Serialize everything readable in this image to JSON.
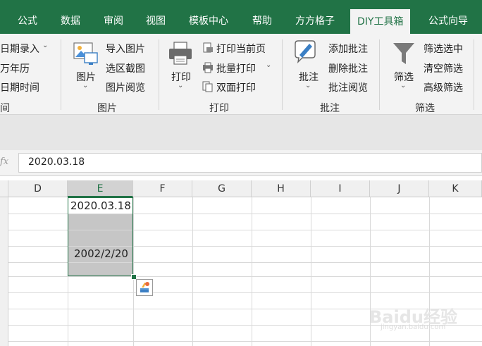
{
  "tabs": [
    "公式",
    "数据",
    "审阅",
    "视图",
    "模板中心",
    "帮助",
    "方方格子",
    "DIY工具箱",
    "公式向导"
  ],
  "ribbon": {
    "date_group": {
      "items": [
        "日期录入",
        "万年历",
        "日期时间"
      ],
      "label": "间"
    },
    "image_group": {
      "big_button": "图片",
      "items": [
        "导入图片",
        "选区截图",
        "图片阅览"
      ],
      "label": "图片"
    },
    "print_group": {
      "big_button": "打印",
      "items": [
        "打印当前页",
        "批量打印",
        "双面打印"
      ],
      "label": "打印"
    },
    "comment_group": {
      "big_button": "批注",
      "items": [
        "添加批注",
        "删除批注",
        "批注阅览"
      ],
      "label": "批注"
    },
    "filter_group": {
      "big_button": "筛选",
      "items": [
        "筛选选中",
        "清空筛选",
        "高级筛选"
      ],
      "label": "筛选"
    }
  },
  "formula_bar": {
    "fx": "fx",
    "value": "2020.03.18"
  },
  "columns": [
    "D",
    "E",
    "F",
    "G",
    "H",
    "I",
    "J",
    "K"
  ],
  "cells": {
    "e1": "2020.03.18",
    "e4": "2002/2/20"
  },
  "watermark": {
    "brand": "Baidu经验",
    "url": "jingyan.baidu.com"
  },
  "colors": {
    "accent": "#217346",
    "selection_fill": "#c6c6c6"
  }
}
